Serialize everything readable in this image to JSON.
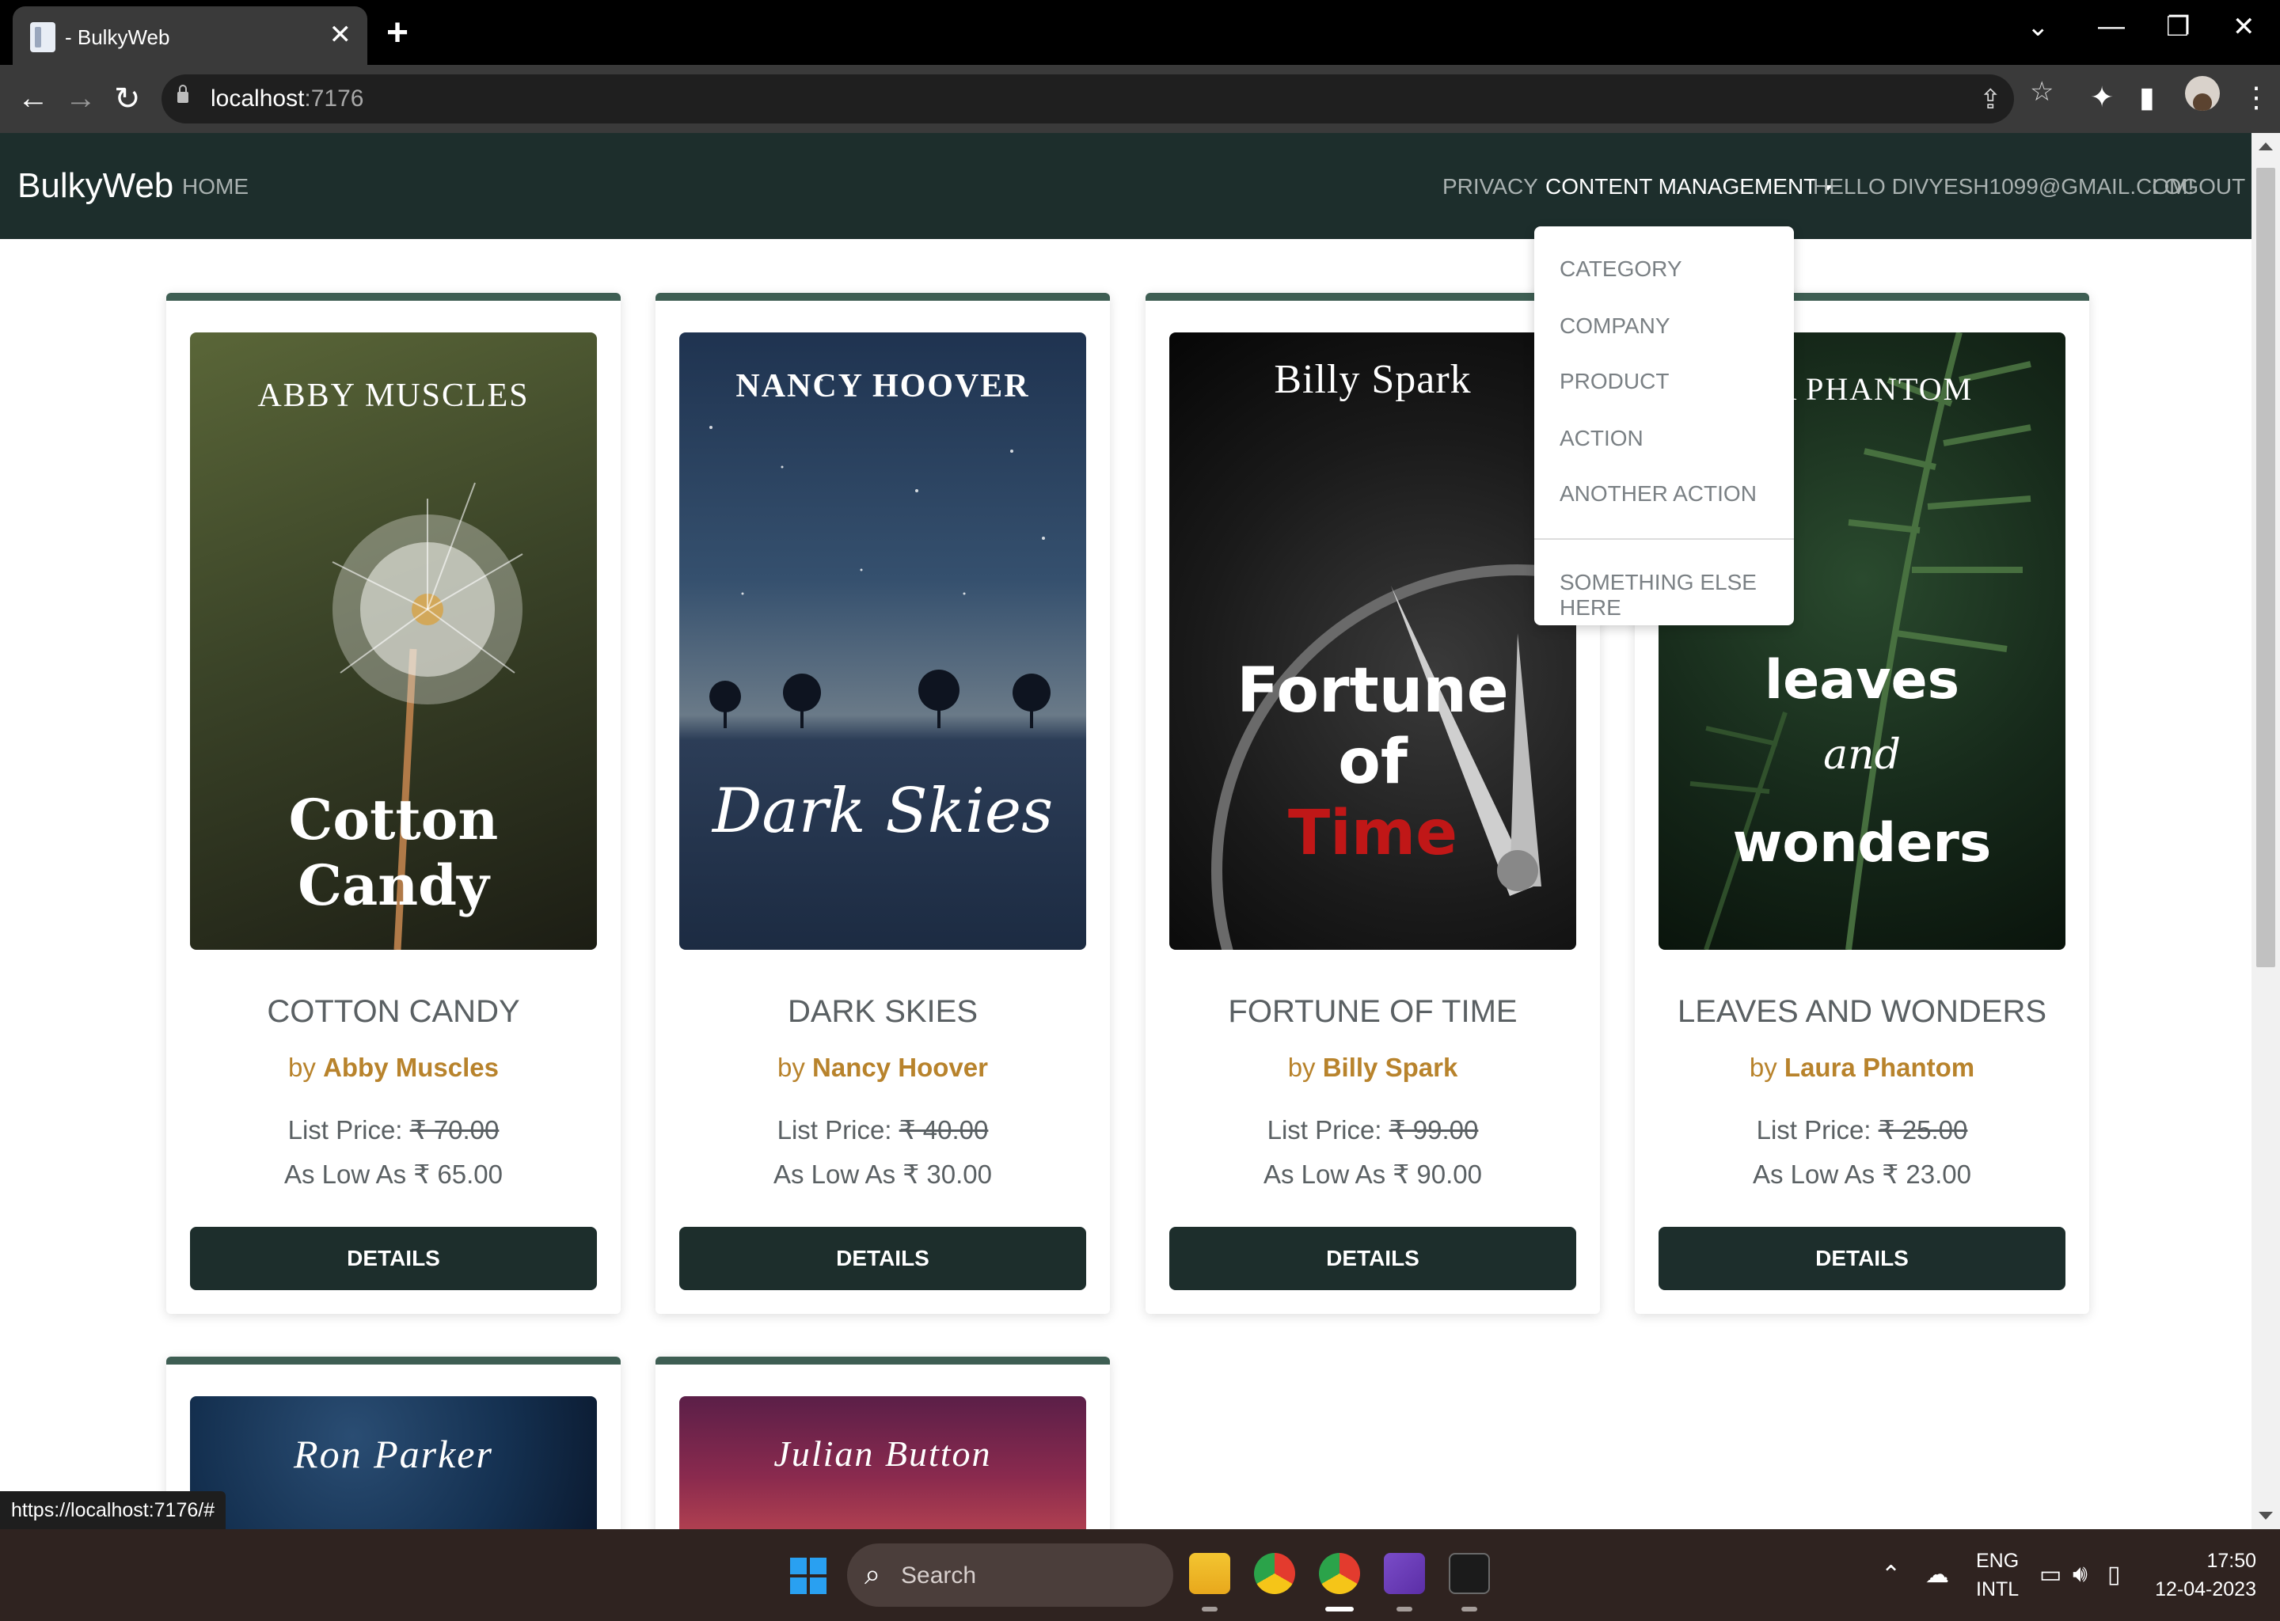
{
  "browser": {
    "tab_title": "- BulkyWeb",
    "tab_close": "✕",
    "new_tab": "+",
    "url_host": "localhost",
    "url_port": ":7176",
    "status_url": "https://localhost:7176/#"
  },
  "navbar": {
    "brand": "BulkyWeb",
    "home": "HOME",
    "privacy": "PRIVACY",
    "content_management": "CONTENT MANAGEMENT",
    "greeting": "HELLO DIVYESH1099@GMAIL.COM!",
    "logout": "LOGOUT"
  },
  "dropdown": {
    "items": [
      "CATEGORY",
      "COMPANY",
      "PRODUCT",
      "ACTION",
      "ANOTHER ACTION"
    ],
    "after_divider": "SOMETHING ELSE HERE"
  },
  "products": [
    {
      "title": "COTTON CANDY",
      "by": "by",
      "author": "Abby Muscles",
      "list_label": "List Price:",
      "list_price": "₹ 70.00",
      "low_label": "As Low As ₹ 65.00",
      "button": "DETAILS",
      "cover_author": "ABBY MUSCLES",
      "cover_title": "Cotton Candy"
    },
    {
      "title": "DARK SKIES",
      "by": "by",
      "author": "Nancy Hoover",
      "list_label": "List Price:",
      "list_price": "₹ 40.00",
      "low_label": "As Low As ₹ 30.00",
      "button": "DETAILS",
      "cover_author": "NANCY HOOVER",
      "cover_title": "Dark Skies"
    },
    {
      "title": "FORTUNE OF TIME",
      "by": "by",
      "author": "Billy Spark",
      "list_label": "List Price:",
      "list_price": "₹ 99.00",
      "low_label": "As Low As ₹ 90.00",
      "button": "DETAILS",
      "cover_author": "Billy Spark",
      "cover_title_1": "Fortune",
      "cover_title_2": "of",
      "cover_title_3": "Time"
    },
    {
      "title": "LEAVES AND WONDERS",
      "by": "by",
      "author": "Laura Phantom",
      "list_label": "List Price:",
      "list_price": "₹ 25.00",
      "low_label": "As Low As ₹ 23.00",
      "button": "DETAILS",
      "cover_author": "RA PHANTOM",
      "cover_title_1": "leaves",
      "cover_title_2": "and",
      "cover_title_3": "wonders"
    }
  ],
  "partial_products": [
    {
      "cover_author": "Ron Parker"
    },
    {
      "cover_author": "Julian Button"
    }
  ],
  "taskbar": {
    "search_label": "Search",
    "lang_1": "ENG",
    "lang_2": "INTL",
    "time": "17:50",
    "date": "12-04-2023"
  },
  "colors": {
    "navbar": "#1d2e2c",
    "card_accent": "#3e5e53",
    "author_link": "#b8832c",
    "button": "#1d2e2c"
  },
  "icons": {
    "back": "arrow-left-icon",
    "forward": "arrow-right-icon",
    "reload": "reload-icon",
    "lock": "lock-icon",
    "share": "share-icon",
    "bookmark": "star-icon",
    "extensions": "puzzle-icon",
    "sidepanel": "side-panel-icon",
    "menu": "kebab-menu-icon"
  }
}
